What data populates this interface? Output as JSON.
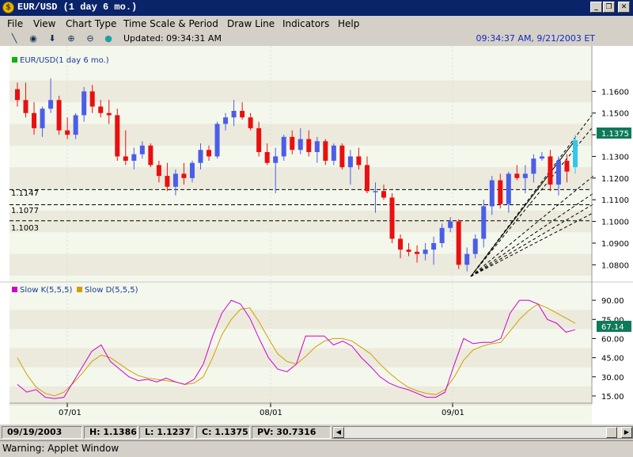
{
  "window": {
    "title": "EUR/USD (1 day  6 mo.)",
    "min": "_",
    "max": "❐",
    "close": "✕"
  },
  "menu": [
    "File",
    "View",
    "Chart Type",
    "Time Scale & Period",
    "Draw Line",
    "Indicators",
    "Help"
  ],
  "toolbar": {
    "updated": "Updated: 09:34:31 AM",
    "clock": "09:34:37 AM, 9/21/2003 ET"
  },
  "chart": {
    "legend": "EUR/USD(1 day  6 mo.)",
    "last_price": "1.1375",
    "price_ticks": [
      "1.1600",
      "1.1500",
      "1.1400",
      "1.1300",
      "1.1200",
      "1.1100",
      "1.1000",
      "1.0900",
      "1.0800"
    ],
    "hlines": [
      "1.1147",
      "1.1077",
      "1.1003"
    ],
    "date_labels": [
      "07/01",
      "08/01",
      "09/01"
    ],
    "osc_legend_k": "Slow K(5,5,5)",
    "osc_legend_d": "Slow D(5,5,5)",
    "osc_ticks": [
      "90.00",
      "75.00",
      "60.00",
      "45.00",
      "30.00",
      "15.00"
    ],
    "osc_last": "67.14",
    "colors": {
      "up": "#4a5ee8",
      "down": "#e81010",
      "k": "#d000d0",
      "d": "#d0a000",
      "last": "#0f7a5a"
    }
  },
  "chart_data": {
    "type": "candlestick",
    "y_range": [
      1.075,
      1.17
    ],
    "osc_range": [
      10,
      100
    ],
    "candles": [
      [
        1.161,
        1.164,
        1.153,
        1.156
      ],
      [
        1.156,
        1.164,
        1.148,
        1.15
      ],
      [
        1.15,
        1.155,
        1.14,
        1.143
      ],
      [
        1.143,
        1.153,
        1.139,
        1.152
      ],
      [
        1.152,
        1.166,
        1.15,
        1.156
      ],
      [
        1.156,
        1.158,
        1.14,
        1.142
      ],
      [
        1.142,
        1.148,
        1.138,
        1.14
      ],
      [
        1.14,
        1.15,
        1.138,
        1.149
      ],
      [
        1.149,
        1.162,
        1.146,
        1.16
      ],
      [
        1.16,
        1.163,
        1.15,
        1.153
      ],
      [
        1.153,
        1.156,
        1.148,
        1.15
      ],
      [
        1.15,
        1.156,
        1.145,
        1.149
      ],
      [
        1.149,
        1.152,
        1.128,
        1.13
      ],
      [
        1.13,
        1.142,
        1.126,
        1.128
      ],
      [
        1.128,
        1.134,
        1.124,
        1.131
      ],
      [
        1.131,
        1.137,
        1.129,
        1.135
      ],
      [
        1.135,
        1.136,
        1.125,
        1.126
      ],
      [
        1.126,
        1.128,
        1.118,
        1.121
      ],
      [
        1.121,
        1.127,
        1.114,
        1.116
      ],
      [
        1.116,
        1.124,
        1.112,
        1.122
      ],
      [
        1.122,
        1.127,
        1.117,
        1.12
      ],
      [
        1.12,
        1.128,
        1.118,
        1.127
      ],
      [
        1.127,
        1.136,
        1.124,
        1.133
      ],
      [
        1.133,
        1.135,
        1.128,
        1.13
      ],
      [
        1.13,
        1.146,
        1.129,
        1.145
      ],
      [
        1.145,
        1.15,
        1.142,
        1.148
      ],
      [
        1.148,
        1.156,
        1.144,
        1.151
      ],
      [
        1.151,
        1.155,
        1.147,
        1.148
      ],
      [
        1.148,
        1.15,
        1.142,
        1.143
      ],
      [
        1.143,
        1.146,
        1.13,
        1.132
      ],
      [
        1.132,
        1.136,
        1.126,
        1.127
      ],
      [
        1.127,
        1.134,
        1.113,
        1.13
      ],
      [
        1.13,
        1.14,
        1.128,
        1.139
      ],
      [
        1.139,
        1.142,
        1.131,
        1.133
      ],
      [
        1.133,
        1.143,
        1.131,
        1.138
      ],
      [
        1.138,
        1.142,
        1.13,
        1.132
      ],
      [
        1.132,
        1.139,
        1.127,
        1.137
      ],
      [
        1.137,
        1.138,
        1.126,
        1.128
      ],
      [
        1.128,
        1.136,
        1.126,
        1.135
      ],
      [
        1.135,
        1.136,
        1.124,
        1.125
      ],
      [
        1.125,
        1.133,
        1.117,
        1.13
      ],
      [
        1.13,
        1.134,
        1.124,
        1.126
      ],
      [
        1.126,
        1.13,
        1.113,
        1.114
      ],
      [
        1.114,
        1.118,
        1.104,
        1.114
      ],
      [
        1.114,
        1.117,
        1.11,
        1.111
      ],
      [
        1.111,
        1.113,
        1.09,
        1.092
      ],
      [
        1.092,
        1.094,
        1.083,
        1.087
      ],
      [
        1.087,
        1.09,
        1.084,
        1.086
      ],
      [
        1.086,
        1.089,
        1.081,
        1.085
      ],
      [
        1.085,
        1.09,
        1.082,
        1.087
      ],
      [
        1.087,
        1.093,
        1.08,
        1.09
      ],
      [
        1.09,
        1.099,
        1.088,
        1.097
      ],
      [
        1.097,
        1.102,
        1.095,
        1.1
      ],
      [
        1.1,
        1.101,
        1.078,
        1.08
      ],
      [
        1.08,
        1.088,
        1.077,
        1.085
      ],
      [
        1.085,
        1.094,
        1.083,
        1.092
      ],
      [
        1.092,
        1.11,
        1.088,
        1.107
      ],
      [
        1.107,
        1.121,
        1.103,
        1.119
      ],
      [
        1.119,
        1.122,
        1.106,
        1.108
      ],
      [
        1.108,
        1.123,
        1.104,
        1.122
      ],
      [
        1.122,
        1.126,
        1.119,
        1.12
      ],
      [
        1.12,
        1.126,
        1.113,
        1.122
      ],
      [
        1.122,
        1.131,
        1.118,
        1.129
      ],
      [
        1.129,
        1.132,
        1.128,
        1.13
      ],
      [
        1.13,
        1.133,
        1.114,
        1.117
      ],
      [
        1.117,
        1.13,
        1.112,
        1.128
      ],
      [
        1.128,
        1.131,
        1.118,
        1.123
      ],
      [
        1.125,
        1.14,
        1.122,
        1.1375
      ]
    ],
    "slow_k": [
      24,
      18,
      20,
      14,
      13,
      14,
      26,
      38,
      50,
      55,
      42,
      36,
      30,
      27,
      28,
      26,
      29,
      26,
      24,
      28,
      40,
      62,
      80,
      90,
      87,
      76,
      60,
      45,
      36,
      34,
      40,
      62,
      62,
      62,
      55,
      58,
      54,
      45,
      38,
      30,
      25,
      22,
      20,
      17,
      14,
      14,
      18,
      40,
      60,
      56,
      57,
      57,
      60,
      80,
      90,
      90,
      87,
      75,
      72,
      65,
      67
    ],
    "slow_d": [
      45,
      32,
      22,
      17,
      15,
      18,
      25,
      33,
      42,
      47,
      45,
      40,
      35,
      31,
      29,
      28,
      27,
      26,
      24,
      25,
      30,
      45,
      63,
      75,
      83,
      84,
      73,
      60,
      48,
      42,
      40,
      46,
      53,
      58,
      60,
      60,
      58,
      53,
      48,
      40,
      33,
      27,
      22,
      19,
      17,
      16,
      20,
      30,
      43,
      51,
      54,
      56,
      57,
      66,
      75,
      82,
      87,
      84,
      80,
      76,
      72
    ]
  },
  "status": {
    "date": "09/19/2003",
    "high": "H: 1.1386",
    "low": "L: 1.1237",
    "close": "C: 1.1375",
    "pv": "PV: 30.7316"
  },
  "warning": "Warning: Applet Window"
}
